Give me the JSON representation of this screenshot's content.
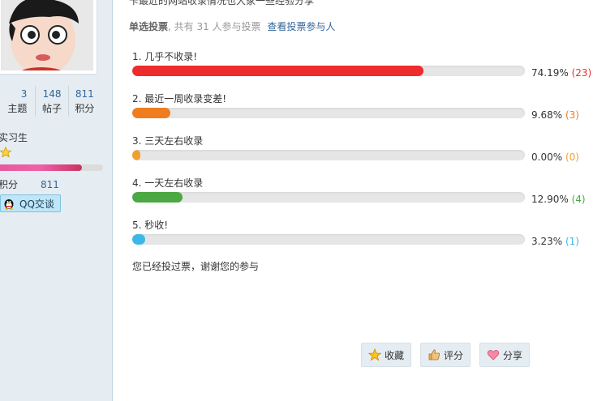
{
  "sidebar": {
    "stats": [
      {
        "num": "3",
        "label": "主题"
      },
      {
        "num": "148",
        "label": "帖子"
      },
      {
        "num": "811",
        "label": "积分"
      }
    ],
    "rank": "实习生",
    "level_percent": 0.8,
    "points_label": "积分",
    "points_value": "811",
    "qq_button": "QQ交谈"
  },
  "poll": {
    "top_cut_text": "卡最近的网站收录情况也大家一些经验分享",
    "type": "单选投票",
    "summary": ", 共有 31 人参与投票",
    "voters_link": "查看投票参与人",
    "options": [
      {
        "label": "1.  几乎不收录!",
        "percent_value": 74.19,
        "percent": "74.19%",
        "count": "(23)",
        "color": "#ee2c2c"
      },
      {
        "label": "2.  最近一周收录变差!",
        "percent_value": 9.68,
        "percent": "9.68%",
        "count": "(3)",
        "color": "#ef7d1e"
      },
      {
        "label": "3.  三天左右收录",
        "percent_value": 0,
        "percent": "0.00%",
        "count": "(0)",
        "color": "#f0a030"
      },
      {
        "label": "4.  一天左右收录",
        "percent_value": 12.9,
        "percent": "12.90%",
        "count": "(4)",
        "color": "#4ca843"
      },
      {
        "label": "5.  秒收!",
        "percent_value": 3.23,
        "percent": "3.23%",
        "count": "(1)",
        "color": "#3cb8e8"
      }
    ],
    "voted_note": "您已经投过票，谢谢您的参与"
  },
  "actions": {
    "favorite": "收藏",
    "rate": "评分",
    "share": "分享"
  }
}
